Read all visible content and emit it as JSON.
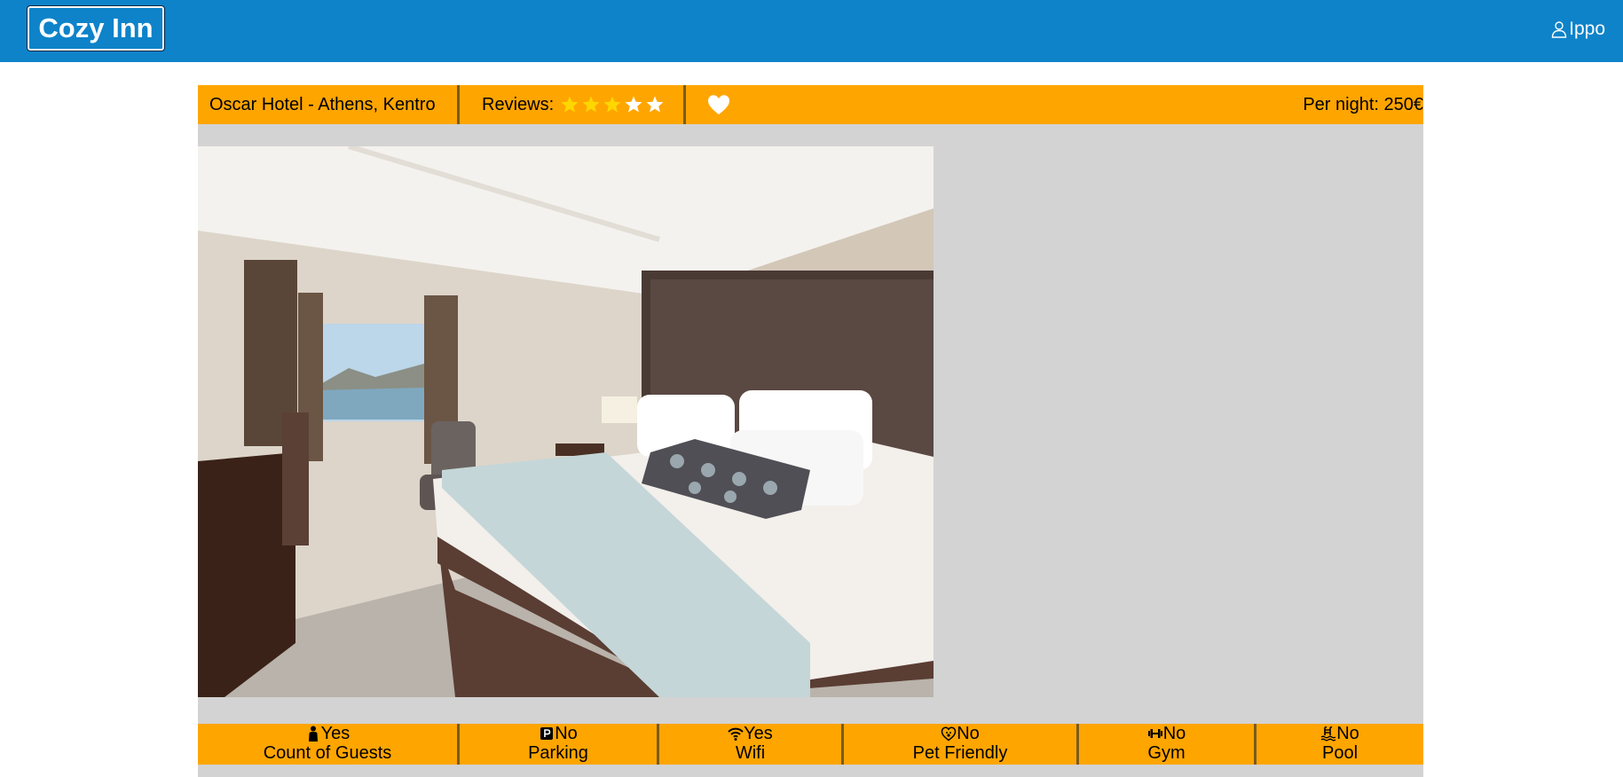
{
  "header": {
    "brand": "Cozy Inn",
    "user_icon": "user-icon",
    "username": "Ippo",
    "bg_color": "#0e83c9"
  },
  "listing": {
    "hotel_name": "Oscar Hotel - Athens, Kentro",
    "reviews_label": "Reviews:",
    "rating": 3,
    "rating_max": 5,
    "star_filled_color": "#ffd700",
    "star_empty_color": "#ffffff",
    "favorite_icon": "heart-icon",
    "price_label": "Per night: 250€",
    "accent_color": "#ffa500"
  },
  "photo": {
    "alt": "hotel-room-photo"
  },
  "amenities": [
    {
      "icon": "person-icon",
      "value": "Yes",
      "label": "Count of Guests"
    },
    {
      "icon": "parking-icon",
      "value": "No",
      "label": "Parking"
    },
    {
      "icon": "wifi-icon",
      "value": "Yes",
      "label": "Wifi"
    },
    {
      "icon": "pet-heart-icon",
      "value": "No",
      "label": "Pet Friendly"
    },
    {
      "icon": "dumbbell-icon",
      "value": "No",
      "label": "Gym"
    },
    {
      "icon": "pool-icon",
      "value": "No",
      "label": "Pool"
    }
  ]
}
